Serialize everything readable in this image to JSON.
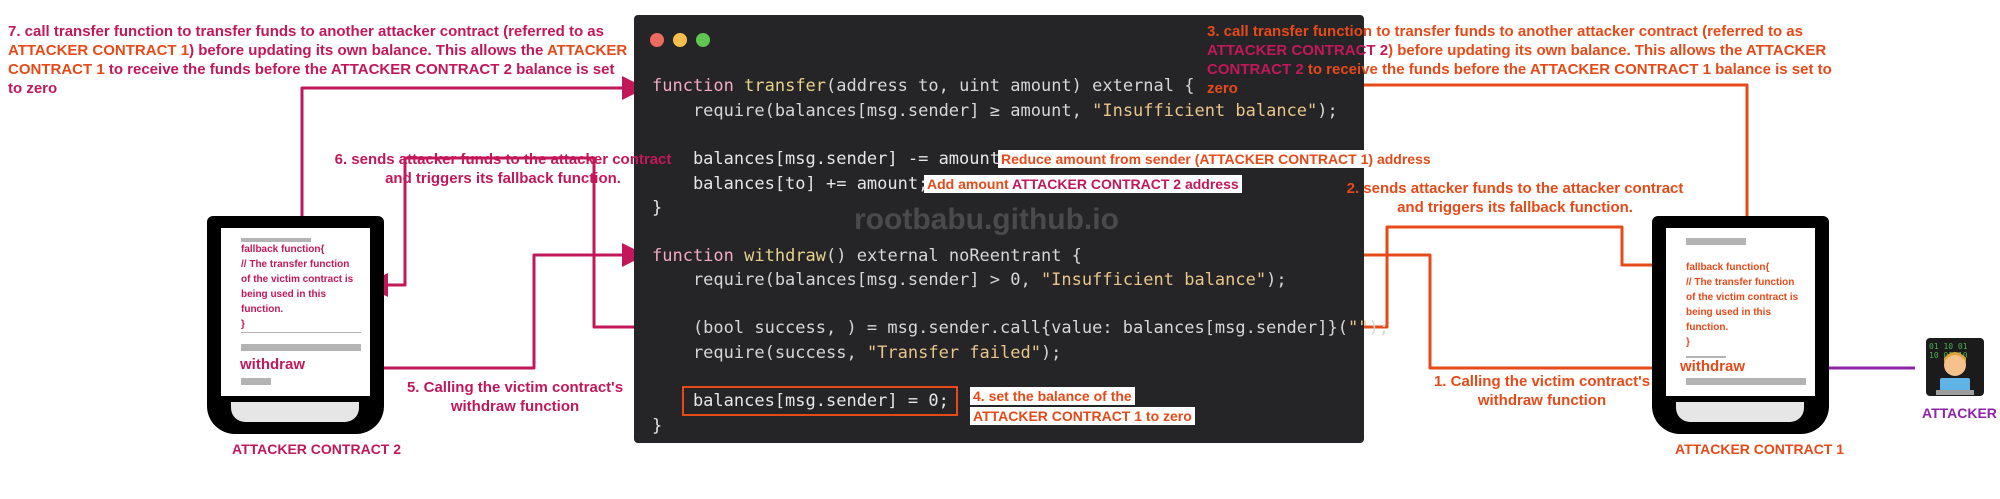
{
  "code": {
    "line1": {
      "kw": "function",
      "name": "transfer",
      "rest": "(address to, uint amount) external {"
    },
    "line2": {
      "pre": "    require(balances[msg.sender] ≥ amount, ",
      "str": "\"Insufficient balance\"",
      "post": ");"
    },
    "line3": "    balances[msg.sender] -= amount;",
    "line4": "    balances[to] += amount;",
    "line5": "}",
    "line6": {
      "kw": "function",
      "name": "withdraw",
      "rest": "() external noReentrant {"
    },
    "line7": {
      "pre": "    require(balances[msg.sender] > 0, ",
      "str": "\"Insufficient balance\"",
      "post": ");"
    },
    "line8": {
      "pre": "    (bool success, ) = msg.sender.call{value: balances[msg.sender]}(",
      "str": "\"\"",
      "post": ");"
    },
    "line9": {
      "pre": "    require(success, ",
      "str": "\"Transfer failed\"",
      "post": ");"
    },
    "line10": "    balances[msg.sender] = 0;",
    "line11": "}"
  },
  "watermark": "rootbabu.github.io",
  "labels": {
    "reduce": "Reduce amount from sender (ATTACKER CONTRACT 1) address",
    "add_prefix": "Add amount ",
    "add_contract": "ATTACKER CONTRACT 2 address",
    "step4_line1": "4. set the balance of the",
    "step4_line2": "ATTACKER CONTRACT 1 to zero"
  },
  "notes": {
    "step7": {
      "l1": "7. call transfer function to transfer funds to another attacker contract (referred to as",
      "l2a": "ATTACKER CONTRACT 1",
      "l2b": ") before updating its own  balance. This allows the ",
      "l2c": "ATTACKER",
      "l3a": "CONTRACT 1",
      "l3b": " to receive the funds before  the ATTACKER CONTRACT 2 balance is set to zero"
    },
    "step3": {
      "l1": "3. call transfer function to transfer funds to another attacker contract (referred to as",
      "l2a": "ATTACKER CONTRACT 2",
      "l2b": ") before updating its own  balance. This allows the ATTACKER",
      "l3a": "CONTRACT 2",
      "l3b": " to receive the funds before  the ATTACKER CONTRACT 1 balance is set to zero"
    },
    "step6": {
      "l1": "6. sends attacker funds to the attacker contract",
      "l2": "and triggers its fallback function."
    },
    "step2": {
      "l1": "2. sends attacker funds to the attacker contract",
      "l2": "and triggers its fallback function."
    },
    "step5": {
      "l1": "5. Calling the victim contract's",
      "l2": "withdraw function"
    },
    "step1": {
      "l1": "1. Calling the victim contract's",
      "l2": "withdraw function"
    }
  },
  "contract2": {
    "fallback": [
      "fallback function{",
      "// The transfer function",
      "of the victim contract is",
      "being used in this",
      "function.",
      "}"
    ],
    "withdraw": "withdraw",
    "caption": "ATTACKER CONTRACT 2"
  },
  "contract1": {
    "fallback": [
      "fallback function{",
      "// The transfer function",
      "of the victim contract is",
      "being used in this",
      "function.",
      "}"
    ],
    "withdraw": "withdraw",
    "caption": "ATTACKER CONTRACT 1"
  },
  "attacker": {
    "label": "ATTACKER",
    "icon": "hacker-avatar-icon"
  },
  "colors": {
    "pink": "#c2185b",
    "orange": "#e64a19",
    "purple": "#8e24aa",
    "code_bg": "#252527"
  }
}
